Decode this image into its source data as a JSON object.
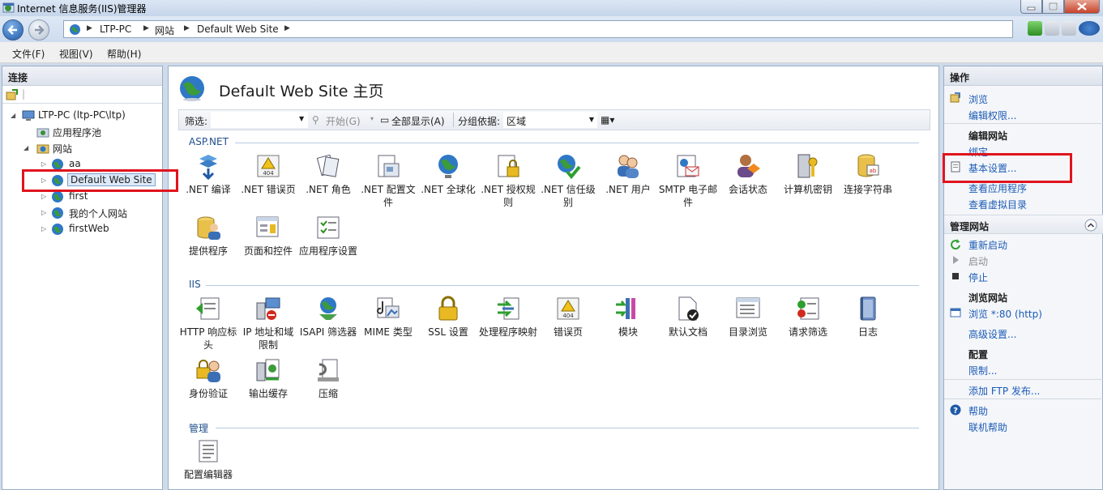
{
  "window": {
    "title": "Internet 信息服务(IIS)管理器"
  },
  "address": {
    "crumbs": [
      "LTP-PC",
      "网站",
      "Default Web Site"
    ]
  },
  "menu": {
    "file": "文件(F)",
    "view": "视图(V)",
    "help": "帮助(H)"
  },
  "connections": {
    "header": "连接",
    "tree": {
      "server": "LTP-PC (ltp-PC\\ltp)",
      "app_pools": "应用程序池",
      "sites": "网站",
      "site_items": [
        "aa",
        "Default Web Site",
        "first",
        "我的个人网站",
        "firstWeb"
      ]
    }
  },
  "center": {
    "heading": "Default Web Site 主页",
    "filter": {
      "label": "筛选:",
      "go": "开始(G)",
      "show_all": "全部显示(A)",
      "group_by": "分组依据:",
      "group_value": "区域"
    },
    "sections": {
      "aspnet": {
        "title": "ASP.NET",
        "items": [
          ".NET 编译",
          ".NET 错误页",
          ".NET 角色",
          ".NET 配置文件",
          ".NET 全球化",
          ".NET 授权规则",
          ".NET 信任级别",
          ".NET 用户",
          "SMTP 电子邮件",
          "会话状态",
          "计算机密钥",
          "连接字符串",
          "提供程序",
          "页面和控件",
          "应用程序设置"
        ]
      },
      "iis": {
        "title": "IIS",
        "items": [
          "HTTP 响应标头",
          "IP 地址和域限制",
          "ISAPI 筛选器",
          "MIME 类型",
          "SSL 设置",
          "处理程序映射",
          "错误页",
          "模块",
          "默认文档",
          "目录浏览",
          "请求筛选",
          "日志",
          "身份验证",
          "输出缓存",
          "压缩"
        ]
      },
      "manage": {
        "title": "管理",
        "items": [
          "配置编辑器"
        ]
      }
    }
  },
  "actions": {
    "header": "操作",
    "explore": "浏览",
    "edit_permissions": "编辑权限...",
    "edit_site": {
      "title": "编辑网站",
      "bindings": "绑定...",
      "basic_settings": "基本设置...",
      "view_apps": "查看应用程序",
      "view_vdirs": "查看虚拟目录"
    },
    "manage_site": {
      "title": "管理网站",
      "restart": "重新启动",
      "start": "启动",
      "stop": "停止",
      "browse_title": "浏览网站",
      "browse_http": "浏览 *:80 (http)",
      "advanced": "高级设置...",
      "config_title": "配置",
      "limits": "限制...",
      "add_ftp": "添加 FTP 发布..."
    },
    "help": "帮助",
    "online_help": "联机帮助"
  },
  "colors": {
    "accent": "#1c5bb7",
    "highlight": "#e0141e",
    "section": "#1f4e8c"
  }
}
